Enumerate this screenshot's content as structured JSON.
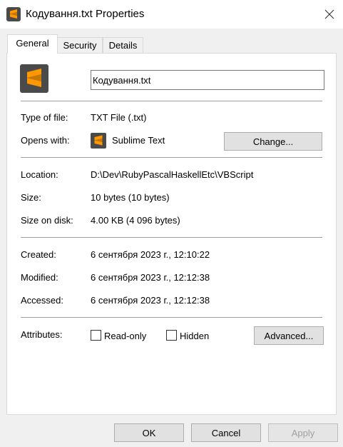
{
  "window": {
    "title": "Кодування.txt Properties",
    "icon": "sublime-text-icon"
  },
  "tabs": [
    {
      "label": "General",
      "active": true
    },
    {
      "label": "Security",
      "active": false
    },
    {
      "label": "Details",
      "active": false
    }
  ],
  "general": {
    "file_name": "Кодування.txt",
    "type_of_file": {
      "label": "Type of file:",
      "value": "TXT File (.txt)"
    },
    "opens_with": {
      "label": "Opens with:",
      "app": "Sublime Text",
      "change_button": "Change..."
    },
    "location": {
      "label": "Location:",
      "value": "D:\\Dev\\RubyPascalHaskellEtc\\VBScript"
    },
    "size": {
      "label": "Size:",
      "value": "10 bytes (10 bytes)"
    },
    "size_on_disk": {
      "label": "Size on disk:",
      "value": "4.00 KB (4 096 bytes)"
    },
    "created": {
      "label": "Created:",
      "value": "6 сентября 2023 г., 12:10:22"
    },
    "modified": {
      "label": "Modified:",
      "value": "6 сентября 2023 г., 12:12:38"
    },
    "accessed": {
      "label": "Accessed:",
      "value": "6 сентября 2023 г., 12:12:38"
    },
    "attributes": {
      "label": "Attributes:",
      "read_only": {
        "label": "Read-only",
        "checked": false
      },
      "hidden": {
        "label": "Hidden",
        "checked": false
      },
      "advanced_button": "Advanced..."
    }
  },
  "footer": {
    "ok": "OK",
    "cancel": "Cancel",
    "apply": "Apply",
    "apply_enabled": false
  },
  "colors": {
    "sublime_orange": "#ff9800",
    "sublime_bg": "#4a4a4a",
    "panel_bg": "#ffffff",
    "dialog_bg": "#f0f0f0"
  }
}
